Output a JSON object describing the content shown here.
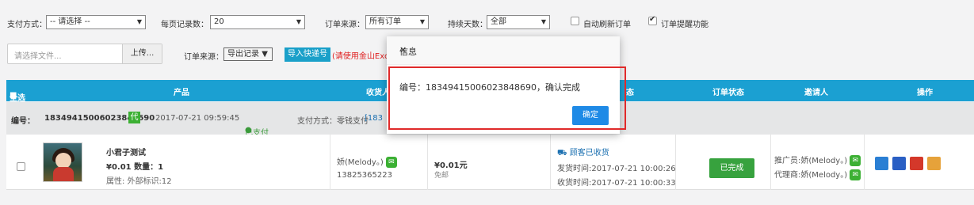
{
  "filters": {
    "payment_label": "支付方式：",
    "payment_value": "-- 请选择 --",
    "per_page_label": "每页记录数：",
    "per_page_value": "20",
    "source_label": "订单来源：",
    "source_value": "所有订单",
    "days_label": "持续天数：",
    "days_value": "全部",
    "auto_refresh_label": "自动刷新订单",
    "auto_refresh_checked": false,
    "remind_label": "订单提醒功能",
    "remind_checked": true
  },
  "import_bar": {
    "file_placeholder": "请选择文件...",
    "upload_label": "上传...",
    "source_label": "订单来源：",
    "source_value": "导出记录",
    "import_button": "导入快递号",
    "import_note": "(请使用金山Exc"
  },
  "table_header": {
    "select_all": "全选",
    "product": "产品",
    "receiver": "收货人",
    "status_col_partial": "态",
    "order_status": "订单状态",
    "inviter": "邀请人",
    "actions": "操作"
  },
  "order": {
    "number_label": "编号：",
    "number": "183494150060238486 90",
    "number_full": "18349415006023848690",
    "tag": "代",
    "datetime": "2017-07-21 09:59:45",
    "paid_label": "已支付",
    "payment_label": "支付方式：零钱支付",
    "payment_extra": "[183",
    "product_name": "小君子测试",
    "price_line": "¥0.01 数量：1",
    "attr_line": "属性: 外部标识:12",
    "receiver_name": "娇(Melody。)",
    "receiver_phone": "13825365223",
    "amount": "¥0.01元",
    "shipping": "免邮",
    "receipt_status": "顾客已收货",
    "ship_time": "发货时间:2017-07-21 10:00:26",
    "receive_time": "收货时间:2017-07-21 10:00:33",
    "order_status": "已完成",
    "promoter": "推广员:娇(Melody。)",
    "agent": "代理商:娇(Melody。)"
  },
  "dialog": {
    "title": "信息",
    "message": "编号：18349415006023848690，确认完成",
    "ok": "确定",
    "close_icon": "close-icon"
  },
  "colors": {
    "header_blue": "#1ba0d2",
    "status_green": "#37a23e",
    "ok_blue": "#1e8ae6",
    "highlight_red": "#e02a2a"
  }
}
